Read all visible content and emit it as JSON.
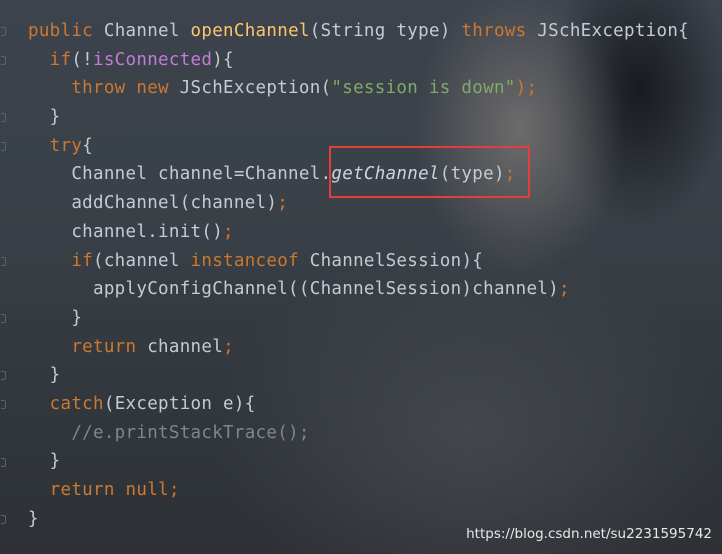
{
  "code_lines": [
    [
      [
        "public ",
        "kw"
      ],
      [
        "Channel ",
        ""
      ],
      [
        "openChannel",
        "fn"
      ],
      [
        "(String type) ",
        ""
      ],
      [
        "throws ",
        "kw"
      ],
      [
        "JSchException{",
        ""
      ]
    ],
    [
      [
        "  "
      ],
      [
        "if",
        "kw"
      ],
      [
        "(!",
        ""
      ],
      [
        "isConnected",
        "fld"
      ],
      [
        "){",
        ""
      ]
    ],
    [
      [
        "    "
      ],
      [
        "throw new ",
        "kw"
      ],
      [
        "JSchException(",
        ""
      ],
      [
        "\"session is down\"",
        "str"
      ],
      [
        ");",
        "kw"
      ]
    ],
    [
      [
        "  "
      ],
      [
        "}",
        ""
      ]
    ],
    [
      [
        "  "
      ],
      [
        "try",
        "kw"
      ],
      [
        "{",
        ""
      ]
    ],
    [
      [
        "    "
      ],
      [
        "Channel channel=Channel.",
        ""
      ],
      [
        "getChannel",
        "it"
      ],
      [
        "(type)",
        ""
      ],
      [
        ";",
        "kw"
      ]
    ],
    [
      [
        "    "
      ],
      [
        "addChannel(channel)",
        ""
      ],
      [
        ";",
        "kw"
      ]
    ],
    [
      [
        "    "
      ],
      [
        "channel.init()",
        ""
      ],
      [
        ";",
        "kw"
      ]
    ],
    [
      [
        "    "
      ],
      [
        "if",
        "kw"
      ],
      [
        "(channel ",
        ""
      ],
      [
        "instanceof ",
        "kw"
      ],
      [
        "ChannelSession){",
        ""
      ]
    ],
    [
      [
        "      "
      ],
      [
        "applyConfigChannel((ChannelSession)channel)",
        ""
      ],
      [
        ";",
        "kw"
      ]
    ],
    [
      [
        "    "
      ],
      [
        "}",
        ""
      ]
    ],
    [
      [
        "    "
      ],
      [
        "return ",
        "kw"
      ],
      [
        "channel",
        ""
      ],
      [
        ";",
        "kw"
      ]
    ],
    [
      [
        "  "
      ],
      [
        "}",
        ""
      ]
    ],
    [
      [
        "  "
      ],
      [
        "catch",
        "kw"
      ],
      [
        "(Exception e){",
        ""
      ]
    ],
    [
      [
        "    "
      ],
      [
        "//e.printStackTrace();",
        "cmt"
      ]
    ],
    [
      [
        "  "
      ],
      [
        "}",
        ""
      ]
    ],
    [
      [
        "  "
      ],
      [
        "return null",
        "kw"
      ],
      [
        ";",
        "kw"
      ]
    ],
    [
      [
        "}",
        ""
      ]
    ]
  ],
  "highlight": {
    "target": "getChannel(type);",
    "color": "#e23e3e"
  },
  "watermark": "https://blog.csdn.net/su2231595742",
  "colors": {
    "keyword": "#cc7832",
    "method_declaration": "#ffc66d",
    "field": "#c27bd6",
    "string": "#7faa6a",
    "comment": "#80868c",
    "default_text": "#c5cbd3"
  }
}
